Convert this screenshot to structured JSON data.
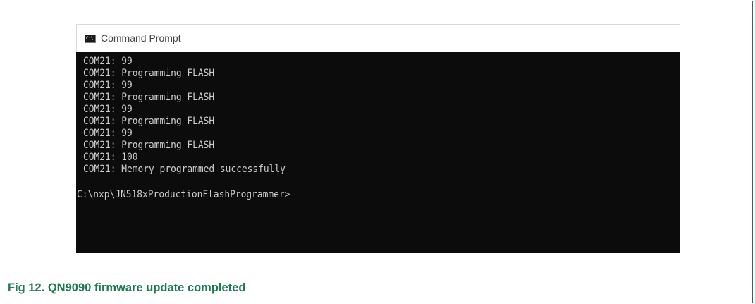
{
  "window": {
    "title": "Command Prompt",
    "icon": "cmd-window-icon",
    "icon_glyph": "C:\\."
  },
  "console": {
    "lines": [
      "COM21: 99",
      "COM21: Programming FLASH",
      "COM21: 99",
      "COM21: Programming FLASH",
      "COM21: 99",
      "COM21: Programming FLASH",
      "COM21: 99",
      "COM21: Programming FLASH",
      "COM21: 100",
      "COM21: Memory programmed successfully"
    ],
    "prompt": "C:\\nxp\\JN518xProductionFlashProgrammer>"
  },
  "caption": {
    "text": "Fig 12. QN9090 firmware update completed"
  },
  "colors": {
    "border": "#1c6e6a",
    "caption": "#1e7a52",
    "console_bg": "#0c0c0c",
    "console_text": "#cccccc"
  }
}
